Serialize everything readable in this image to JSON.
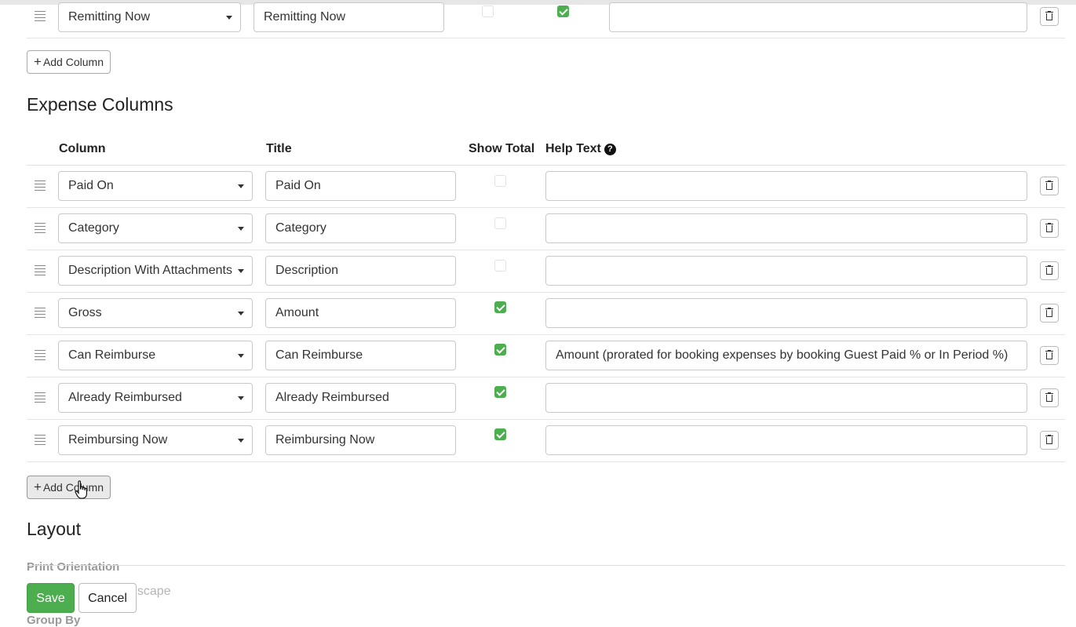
{
  "top_row": {
    "column": "Remitting Now",
    "title": "Remitting Now",
    "help_text": "",
    "show_total_a": false,
    "show_total_b": true
  },
  "revenue_add_column": "Add Column",
  "expense_section": {
    "title": "Expense Columns",
    "headers": {
      "column": "Column",
      "title": "Title",
      "show_total": "Show Total",
      "help_text": "Help Text",
      "help_icon": "?"
    },
    "rows": [
      {
        "column": "Paid On",
        "title": "Paid On",
        "show_total": false,
        "help_text": ""
      },
      {
        "column": "Category",
        "title": "Category",
        "show_total": false,
        "help_text": ""
      },
      {
        "column": "Description With Attachments",
        "title": "Description",
        "show_total": false,
        "help_text": ""
      },
      {
        "column": "Gross",
        "title": "Amount",
        "show_total": true,
        "help_text": ""
      },
      {
        "column": "Can Reimburse",
        "title": "Can Reimburse",
        "show_total": true,
        "help_text": "Amount (prorated for booking expenses by booking Guest Paid % or In Period %)"
      },
      {
        "column": "Already Reimbursed",
        "title": "Already Reimbursed",
        "show_total": true,
        "help_text": ""
      },
      {
        "column": "Reimbursing Now",
        "title": "Reimbursing Now",
        "show_total": true,
        "help_text": ""
      }
    ],
    "add_column": "Add Column"
  },
  "layout_section": {
    "title": "Layout",
    "print_orientation_label": "Print Orientation",
    "orientation_partial": "dscape",
    "group_by_label": "Group By"
  },
  "footer": {
    "save": "Save",
    "cancel": "Cancel"
  },
  "icons": {
    "drag": "drag-handle-icon",
    "trash": "trash-icon",
    "help": "question-circle-icon",
    "caret": "caret-down-icon",
    "plus": "plus-icon",
    "cursor": "hand-pointer-icon"
  },
  "colors": {
    "accent_green": "#4cae4f"
  }
}
